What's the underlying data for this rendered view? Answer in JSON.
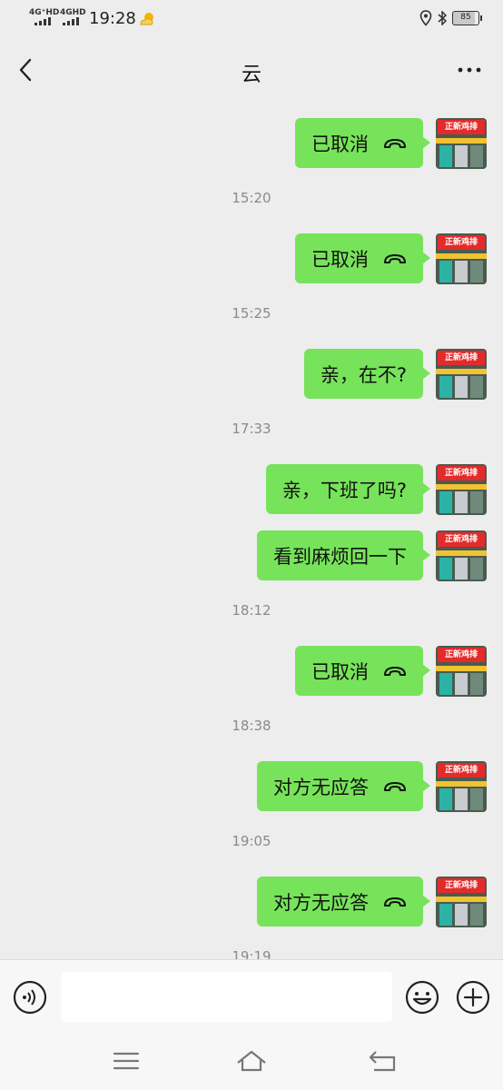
{
  "status_bar": {
    "sim1_label": "4G⁺HD",
    "sim2_label": "4GHD",
    "time": "19:28",
    "weather_icon": "sun-cloud-icon",
    "location_icon": "location-icon",
    "bluetooth_icon": "bluetooth-icon",
    "battery_level": "85"
  },
  "nav": {
    "title": "云",
    "back_icon": "chevron-left-icon",
    "more_icon": "more-dots-icon"
  },
  "colors": {
    "bubble": "#77e35a",
    "background": "#ededed",
    "timestamp": "#8a8a8a"
  },
  "avatar": {
    "sign_text": "正新鸡排"
  },
  "messages": [
    {
      "text": "已取消",
      "icon": "phone-hangup-icon"
    },
    {
      "time": "15:20"
    },
    {
      "text": "已取消",
      "icon": "phone-hangup-icon"
    },
    {
      "time": "15:25"
    },
    {
      "text": "亲，在不?"
    },
    {
      "time": "17:33"
    },
    {
      "text": "亲，下班了吗?"
    },
    {
      "text": "看到麻烦回一下"
    },
    {
      "time": "18:12"
    },
    {
      "text": "已取消",
      "icon": "phone-hangup-icon"
    },
    {
      "time": "18:38"
    },
    {
      "text": "对方无应答",
      "icon": "phone-hangup-icon"
    },
    {
      "time": "19:05"
    },
    {
      "text": "对方无应答",
      "icon": "phone-hangup-icon"
    },
    {
      "time": "19:19"
    }
  ],
  "input_bar": {
    "value": "",
    "voice_icon": "voice-icon",
    "emoji_icon": "emoji-icon",
    "plus_icon": "plus-icon"
  },
  "system_nav": {
    "menu_icon": "menu-icon",
    "home_icon": "home-icon",
    "back_icon": "back-arrow-icon"
  }
}
